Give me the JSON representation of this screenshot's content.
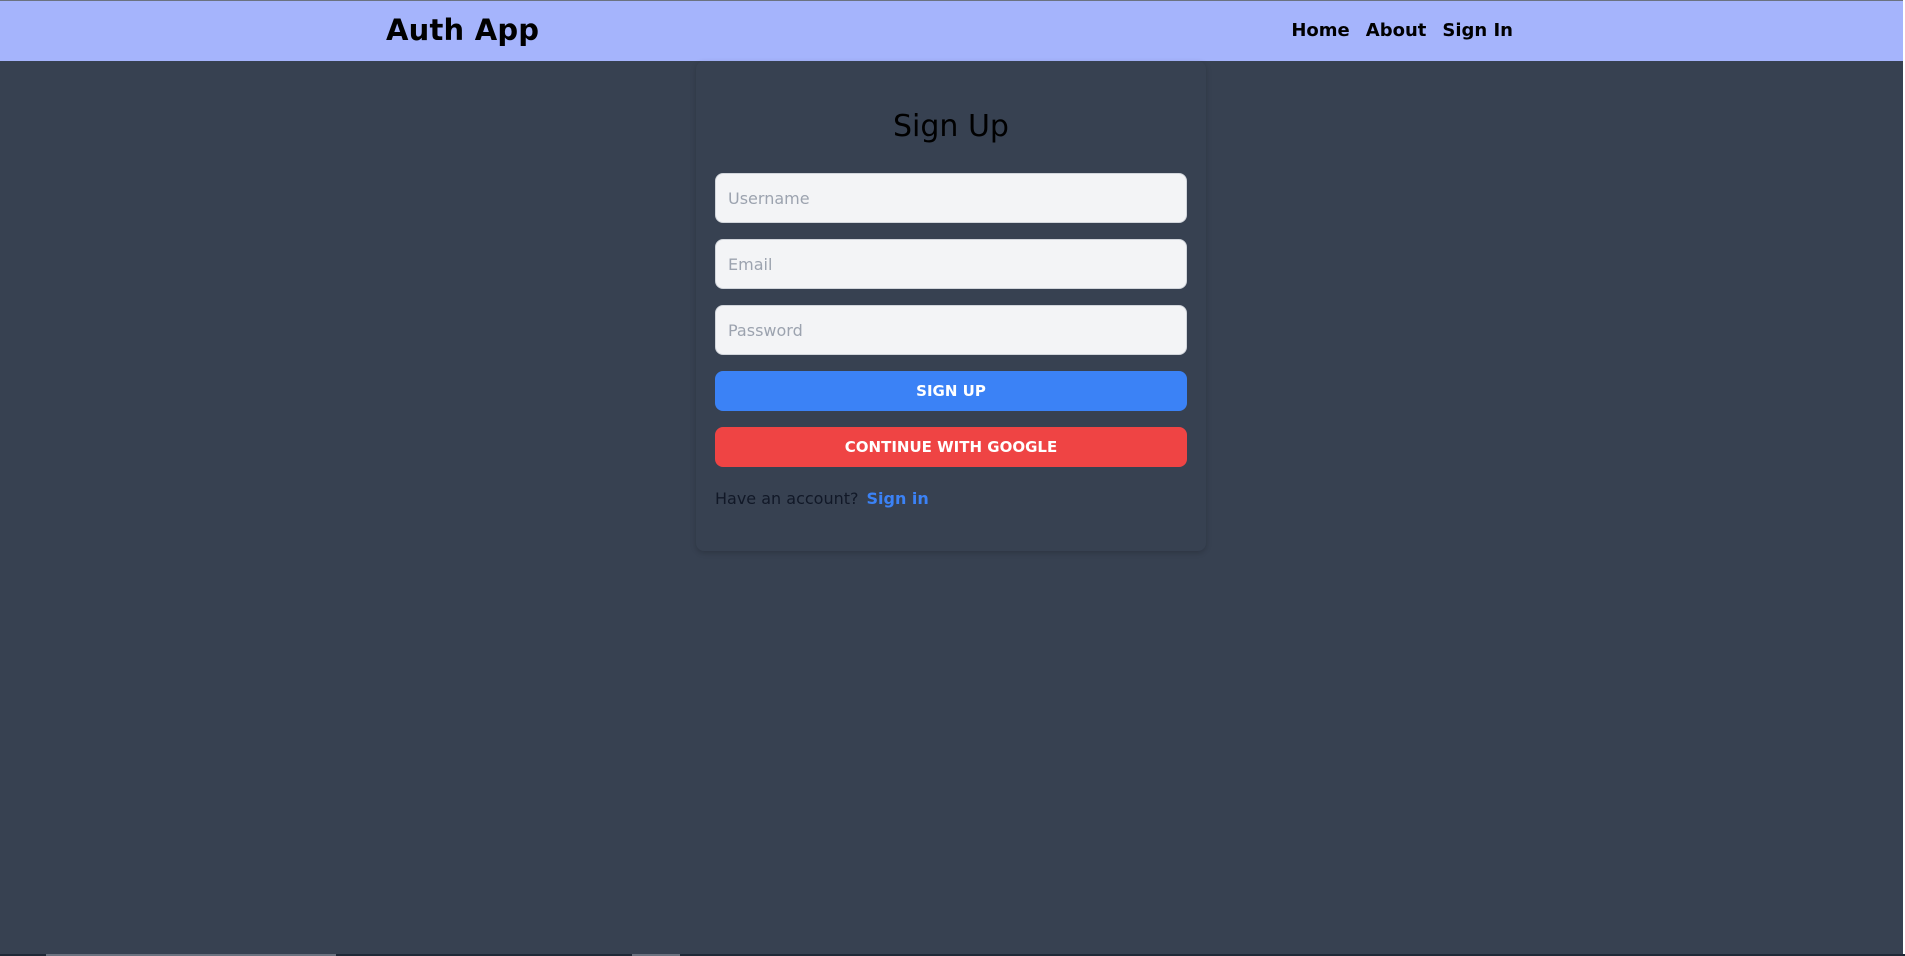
{
  "header": {
    "brand": "Auth App",
    "nav": [
      {
        "label": "Home"
      },
      {
        "label": "About"
      },
      {
        "label": "Sign In"
      }
    ],
    "background_color": "#a5b4fc"
  },
  "form": {
    "title": "Sign Up",
    "username": {
      "placeholder": "Username",
      "value": ""
    },
    "email": {
      "placeholder": "Email",
      "value": ""
    },
    "password": {
      "placeholder": "Password",
      "value": ""
    },
    "signup_button": "SIGN UP",
    "google_button": "CONTINUE WITH GOOGLE",
    "have_account_text": "Have an account?",
    "signin_link": "Sign in"
  },
  "colors": {
    "page_background": "#374151",
    "primary": "#3b82f6",
    "danger": "#ef4444"
  }
}
